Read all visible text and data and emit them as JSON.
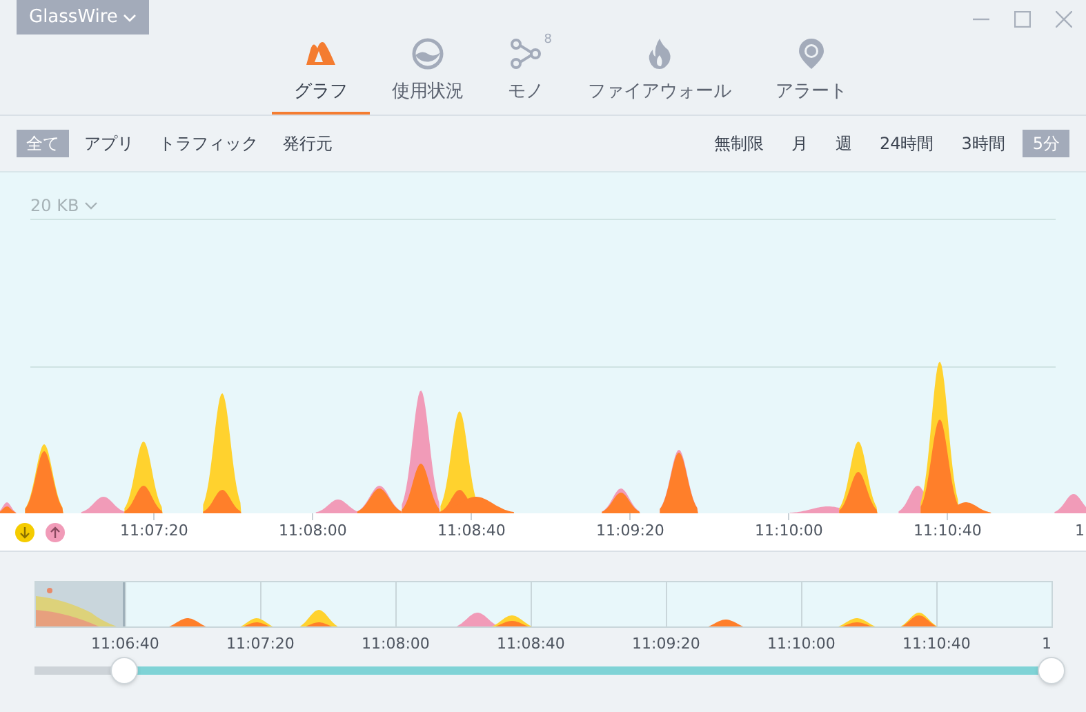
{
  "app_menu": {
    "label": "GlassWire"
  },
  "nav_tabs": [
    {
      "label": "グラフ",
      "selected": true
    },
    {
      "label": "使用状況",
      "selected": false
    },
    {
      "label": "モノ",
      "badge": "8",
      "selected": false
    },
    {
      "label": "ファイアウォール",
      "selected": false
    },
    {
      "label": "アラート",
      "selected": false
    }
  ],
  "filters": [
    {
      "label": "全て",
      "selected": true
    },
    {
      "label": "アプリ",
      "selected": false
    },
    {
      "label": "トラフィック",
      "selected": false
    },
    {
      "label": "発行元",
      "selected": false
    }
  ],
  "ranges": [
    {
      "label": "無制限",
      "selected": false
    },
    {
      "label": "月",
      "selected": false
    },
    {
      "label": "週",
      "selected": false
    },
    {
      "label": "24時間",
      "selected": false
    },
    {
      "label": "3時間",
      "selected": false
    },
    {
      "label": "5分",
      "selected": true
    }
  ],
  "graph": {
    "scale": "20 KB",
    "time_labels": [
      "11:07:20",
      "11:08:00",
      "11:08:40",
      "11:09:20",
      "11:10:00",
      "11:10:40",
      "1"
    ]
  },
  "overview": {
    "time_labels": [
      "11:06:40",
      "11:07:20",
      "11:08:00",
      "11:08:40",
      "11:09:20",
      "11:10:00",
      "11:10:40",
      "1"
    ],
    "level": 0.912
  }
}
